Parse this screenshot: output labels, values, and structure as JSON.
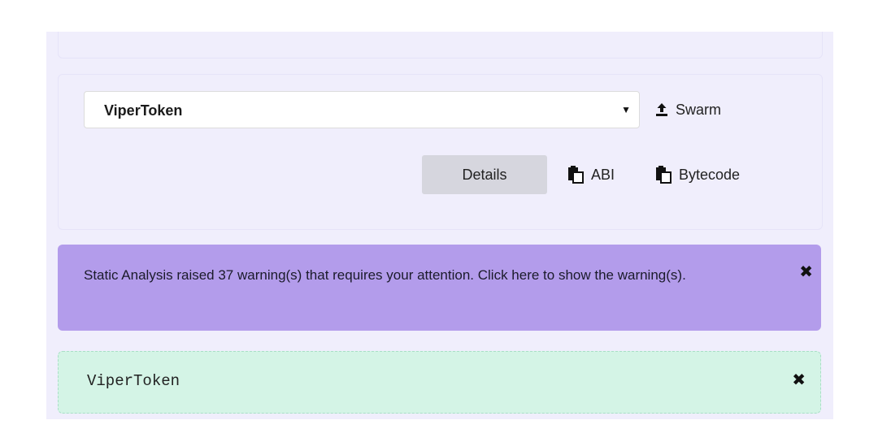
{
  "compile": {
    "selected_contract": "ViperToken",
    "swarm_label": "Swarm",
    "details_label": "Details",
    "abi_label": "ABI",
    "bytecode_label": "Bytecode"
  },
  "alerts": {
    "warning_text": "Static Analysis raised 37 warning(s) that requires your attention. Click here to show the warning(s).",
    "contract_name": "ViperToken",
    "close_glyph": "✖"
  },
  "colors": {
    "panel_bg": "#f0eefc",
    "warning_bg": "#b39ceb",
    "success_bg": "#d4f4e6"
  },
  "icons": {
    "swarm": "upload-icon",
    "abi": "clipboard-icon",
    "bytecode": "clipboard-icon",
    "dropdown": "caret-down-icon",
    "close": "close-icon"
  }
}
